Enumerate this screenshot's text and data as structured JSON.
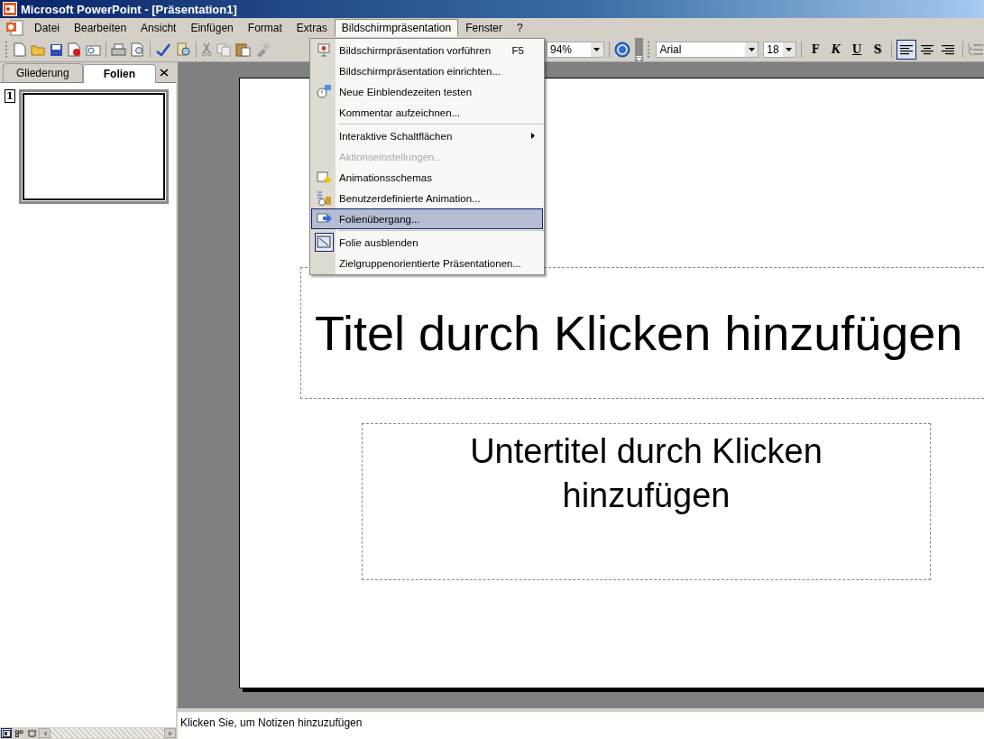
{
  "window": {
    "title": "Microsoft PowerPoint - [Präsentation1]"
  },
  "menu_bar": [
    {
      "label": "Datei",
      "selected": false
    },
    {
      "label": "Bearbeiten",
      "selected": false
    },
    {
      "label": "Ansicht",
      "selected": false
    },
    {
      "label": "Einfügen",
      "selected": false
    },
    {
      "label": "Format",
      "selected": false
    },
    {
      "label": "Extras",
      "selected": false
    },
    {
      "label": "Bildschirmpräsentation",
      "selected": true
    },
    {
      "label": "Fenster",
      "selected": false
    },
    {
      "label": "?",
      "selected": false
    }
  ],
  "dropdown": [
    {
      "kind": "item",
      "label": "Bildschirmpräsentation vorführen",
      "shortcut": "F5",
      "disabled": false,
      "selected": false,
      "checked": false,
      "submenu": false
    },
    {
      "kind": "item",
      "label": "Bildschirmpräsentation einrichten...",
      "disabled": false,
      "selected": false,
      "checked": false,
      "submenu": false
    },
    {
      "kind": "item",
      "label": "Neue Einblendezeiten testen",
      "disabled": false,
      "selected": false,
      "checked": false,
      "submenu": false
    },
    {
      "kind": "item",
      "label": "Kommentar aufzeichnen...",
      "disabled": false,
      "selected": false,
      "checked": false,
      "submenu": false
    },
    {
      "kind": "separator"
    },
    {
      "kind": "item",
      "label": "Interaktive Schaltflächen",
      "disabled": false,
      "selected": false,
      "checked": false,
      "submenu": true
    },
    {
      "kind": "item",
      "label": "Aktionseinstellungen...",
      "disabled": true,
      "selected": false,
      "checked": false,
      "submenu": false
    },
    {
      "kind": "item",
      "label": "Animationsschemas",
      "disabled": false,
      "selected": false,
      "checked": false,
      "submenu": false
    },
    {
      "kind": "item",
      "label": "Benutzerdefinierte Animation...",
      "disabled": false,
      "selected": false,
      "checked": false,
      "submenu": false
    },
    {
      "kind": "item",
      "label": "Folienübergang...",
      "disabled": false,
      "selected": true,
      "checked": false,
      "submenu": false
    },
    {
      "kind": "separator"
    },
    {
      "kind": "item",
      "label": "Folie ausblenden",
      "disabled": false,
      "selected": false,
      "checked": true,
      "submenu": false
    },
    {
      "kind": "item",
      "label": "Zielgruppenorientierte Präsentationen...",
      "disabled": false,
      "selected": false,
      "checked": false,
      "submenu": false
    }
  ],
  "toolbar": {
    "zoom": "94%",
    "font": "Arial",
    "font_size": "18",
    "format_buttons": [
      {
        "label": "F",
        "pressed": false
      },
      {
        "label": "K",
        "pressed": false
      },
      {
        "label": "U",
        "pressed": false
      },
      {
        "label": "S",
        "pressed": false
      }
    ],
    "alignment": [
      {
        "selected": true
      },
      {
        "selected": false
      },
      {
        "selected": false
      }
    ]
  },
  "side_panel": {
    "tabs": [
      {
        "label": "Gliederung",
        "selected": false
      },
      {
        "label": "Folien",
        "selected": true
      }
    ],
    "slides": [
      {
        "number": "1",
        "selected": true
      }
    ],
    "views": [
      {
        "selected": true
      },
      {
        "selected": false
      },
      {
        "selected": false
      }
    ]
  },
  "slide": {
    "title": "Titel durch Klicken hinzufügen",
    "subtitle": "Untertitel durch Klicken hinzufügen"
  },
  "notes": {
    "placeholder": "Klicken Sie, um Notizen hinzuzufügen"
  }
}
